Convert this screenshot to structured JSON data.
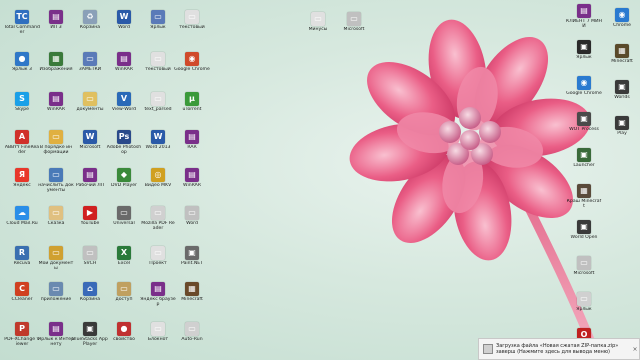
{
  "icons": [
    {
      "label": "Total Commander",
      "glyph": "TC",
      "color": "#2f6fbf"
    },
    {
      "label": "Ярлык 3",
      "glyph": "●",
      "color": "#2f78c8"
    },
    {
      "label": "Skype",
      "glyph": "S",
      "color": "#1aa0e8"
    },
    {
      "label": "ABBYY FineReader",
      "glyph": "A",
      "color": "#d0302a"
    },
    {
      "label": "Яндекс",
      "glyph": "Я",
      "color": "#e8372a"
    },
    {
      "label": "Cloud Mail.Ru",
      "glyph": "☁",
      "color": "#2a8ee8"
    },
    {
      "label": "Recuva",
      "glyph": "R",
      "color": "#3a6fb0"
    },
    {
      "label": "CCleaner",
      "glyph": "C",
      "color": "#d04020"
    },
    {
      "label": "PDF-XChange Viewer",
      "glyph": "P",
      "color": "#c0392b"
    },
    {
      "label": "ИП 3",
      "glyph": "▤",
      "color": "#7a2f8a"
    },
    {
      "label": "Изображения",
      "glyph": "▦",
      "color": "#3a7a3a"
    },
    {
      "label": "WinRAR",
      "glyph": "▤",
      "color": "#7a2f8a"
    },
    {
      "label": "В порядке информации",
      "glyph": "▭",
      "color": "#e0b040"
    },
    {
      "label": "начислить документы",
      "glyph": "▭",
      "color": "#4a7ab8"
    },
    {
      "label": "Сказка",
      "glyph": "▭",
      "color": "#e0c080"
    },
    {
      "label": "Мои документы",
      "glyph": "▭",
      "color": "#d0a030"
    },
    {
      "label": "приложение",
      "glyph": "▭",
      "color": "#6a8ab0"
    },
    {
      "label": "Ярлык к Интернету",
      "glyph": "▤",
      "color": "#7a2f8a"
    },
    {
      "label": "Корзина",
      "glyph": "♻",
      "color": "#8aa0b8"
    },
    {
      "label": "ЗАМЕТКИ",
      "glyph": "▭",
      "color": "#5a7ab8"
    },
    {
      "label": "документы",
      "glyph": "▭",
      "color": "#e0c060"
    },
    {
      "label": "Microsoft",
      "glyph": "W",
      "color": "#2a5aa8"
    },
    {
      "label": "Рабочий ЛП",
      "glyph": "▤",
      "color": "#7a2f8a"
    },
    {
      "label": "YouTube",
      "glyph": "▶",
      "color": "#d02020"
    },
    {
      "label": "SVCH",
      "glyph": "▭",
      "color": "#c0c0c0"
    },
    {
      "label": "Корзина",
      "glyph": "⌂",
      "color": "#3a6ab8"
    },
    {
      "label": "BlueStacks App Player",
      "glyph": "▣",
      "color": "#3a3a3a"
    },
    {
      "label": "Word",
      "glyph": "W",
      "color": "#2a5aa8"
    },
    {
      "label": "WinRAR",
      "glyph": "▤",
      "color": "#7a2f8a"
    },
    {
      "label": "View-Word",
      "glyph": "V",
      "color": "#2a6ab8"
    },
    {
      "label": "Adobe Photoshop",
      "glyph": "Ps",
      "color": "#2a4a8a"
    },
    {
      "label": "DVD Player",
      "glyph": "◆",
      "color": "#3a8a3a"
    },
    {
      "label": "Universal",
      "glyph": "▭",
      "color": "#6a6a6a"
    },
    {
      "label": "Excel",
      "glyph": "X",
      "color": "#2a7a3a"
    },
    {
      "label": "доступ",
      "glyph": "▭",
      "color": "#c0a060"
    },
    {
      "label": "свойство",
      "glyph": "●",
      "color": "#c03030"
    },
    {
      "label": "Ярлык",
      "glyph": "▭",
      "color": "#5a7ab8"
    },
    {
      "label": "текстовый",
      "glyph": "▭",
      "color": "#e0e0e0"
    },
    {
      "label": "text_parsed",
      "glyph": "▭",
      "color": "#e0e0e0"
    },
    {
      "label": "Word 2013",
      "glyph": "W",
      "color": "#2a5aa8"
    },
    {
      "label": "Видео MKV",
      "glyph": "◎",
      "color": "#d0a020"
    },
    {
      "label": "Mozilla PDF Reader",
      "glyph": "▭",
      "color": "#d0d0d0"
    },
    {
      "label": "Проект",
      "glyph": "▭",
      "color": "#e0e0e0"
    },
    {
      "label": "Яндекс браузер",
      "glyph": "▤",
      "color": "#7a2f8a"
    },
    {
      "label": "Блокнот",
      "glyph": "▭",
      "color": "#e0e0e0"
    },
    {
      "label": "текстовый",
      "glyph": "▭",
      "color": "#e0e0e0"
    },
    {
      "label": "Google Chrome",
      "glyph": "◉",
      "color": "#d04a2a"
    },
    {
      "label": "uTorrent",
      "glyph": "µ",
      "color": "#3a9a3a"
    },
    {
      "label": "RAR",
      "glyph": "▤",
      "color": "#7a2f8a"
    },
    {
      "label": "WinRAR",
      "glyph": "▤",
      "color": "#7a2f8a"
    },
    {
      "label": "Word",
      "glyph": "▭",
      "color": "#c0c0c0"
    },
    {
      "label": "Paint.NET",
      "glyph": "▣",
      "color": "#6a6a6a"
    },
    {
      "label": "Minecraft",
      "glyph": "▦",
      "color": "#6a4a2a"
    },
    {
      "label": "Auto-Run",
      "glyph": "▭",
      "color": "#d0d0d0"
    },
    {
      "label": "Минусы",
      "glyph": "▭",
      "color": "#e0e0e0"
    },
    {
      "label": "Microsoft",
      "glyph": "▭",
      "color": "#c0c0c0"
    },
    {
      "label": "КЛИЕНТ 7 МИНИ",
      "glyph": "▤",
      "color": "#7a2f8a"
    },
    {
      "label": "Ярлык",
      "glyph": "▣",
      "color": "#2a2a2a"
    },
    {
      "label": "Google Chrome",
      "glyph": "◉",
      "color": "#2a7ad0"
    },
    {
      "label": "WOT Process",
      "glyph": "▣",
      "color": "#4a4a4a"
    },
    {
      "label": "Launcher",
      "glyph": "▣",
      "color": "#3a6a3a"
    },
    {
      "label": "Краш Minecraft",
      "glyph": "▦",
      "color": "#5a4a3a"
    },
    {
      "label": "World Open",
      "glyph": "▣",
      "color": "#3a3a3a"
    },
    {
      "label": "Microsoft",
      "glyph": "▭",
      "color": "#c0c0c0"
    },
    {
      "label": "Ярлык",
      "glyph": "▭",
      "color": "#d0d0d0"
    },
    {
      "label": "Opera",
      "glyph": "O",
      "color": "#c02020"
    },
    {
      "label": "Chrome",
      "glyph": "◉",
      "color": "#2a7ad0"
    },
    {
      "label": "Minecraft",
      "glyph": "▦",
      "color": "#5a4a2a"
    },
    {
      "label": "Worlds",
      "glyph": "▣",
      "color": "#3a3a3a"
    },
    {
      "label": "Play",
      "glyph": "▣",
      "color": "#3a3a3a"
    }
  ],
  "toast": {
    "text": "Загрузка файла «Новая сжатая ZIP-папка.zip» заверш (Нажмите здесь для вывода меню)",
    "close": "×"
  }
}
